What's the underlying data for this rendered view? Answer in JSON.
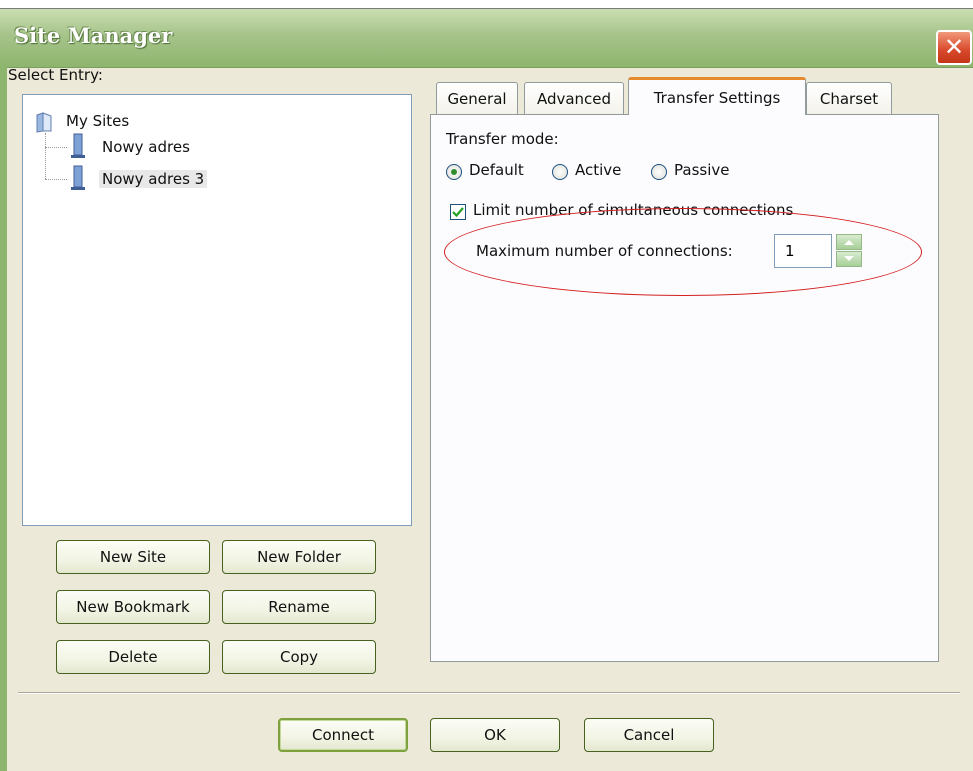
{
  "window": {
    "title": "Site Manager"
  },
  "select_entry_label": "Select Entry:",
  "tree": {
    "root": "My Sites",
    "items": [
      {
        "label": "Nowy adres",
        "selected": false
      },
      {
        "label": "Nowy adres 3",
        "selected": true
      }
    ]
  },
  "left_buttons": {
    "new_site": "New Site",
    "new_folder": "New Folder",
    "new_bookmark": "New Bookmark",
    "rename": "Rename",
    "delete": "Delete",
    "copy": "Copy"
  },
  "tabs": [
    {
      "label": "General",
      "active": false
    },
    {
      "label": "Advanced",
      "active": false
    },
    {
      "label": "Transfer Settings",
      "active": true
    },
    {
      "label": "Charset",
      "active": false
    }
  ],
  "transfer": {
    "mode_label": "Transfer mode:",
    "modes": [
      {
        "label": "Default",
        "checked": true
      },
      {
        "label": "Active",
        "checked": false
      },
      {
        "label": "Passive",
        "checked": false
      }
    ],
    "limit_label": "Limit number of simultaneous connections",
    "limit_checked": true,
    "max_label": "Maximum number of connections:",
    "max_value": "1"
  },
  "bottom_buttons": {
    "connect": "Connect",
    "ok": "OK",
    "cancel": "Cancel"
  },
  "colors": {
    "title_bar": "#a6c48a",
    "annotation_ellipse": "#d42020",
    "active_tab_accent": "#e68b2c"
  }
}
